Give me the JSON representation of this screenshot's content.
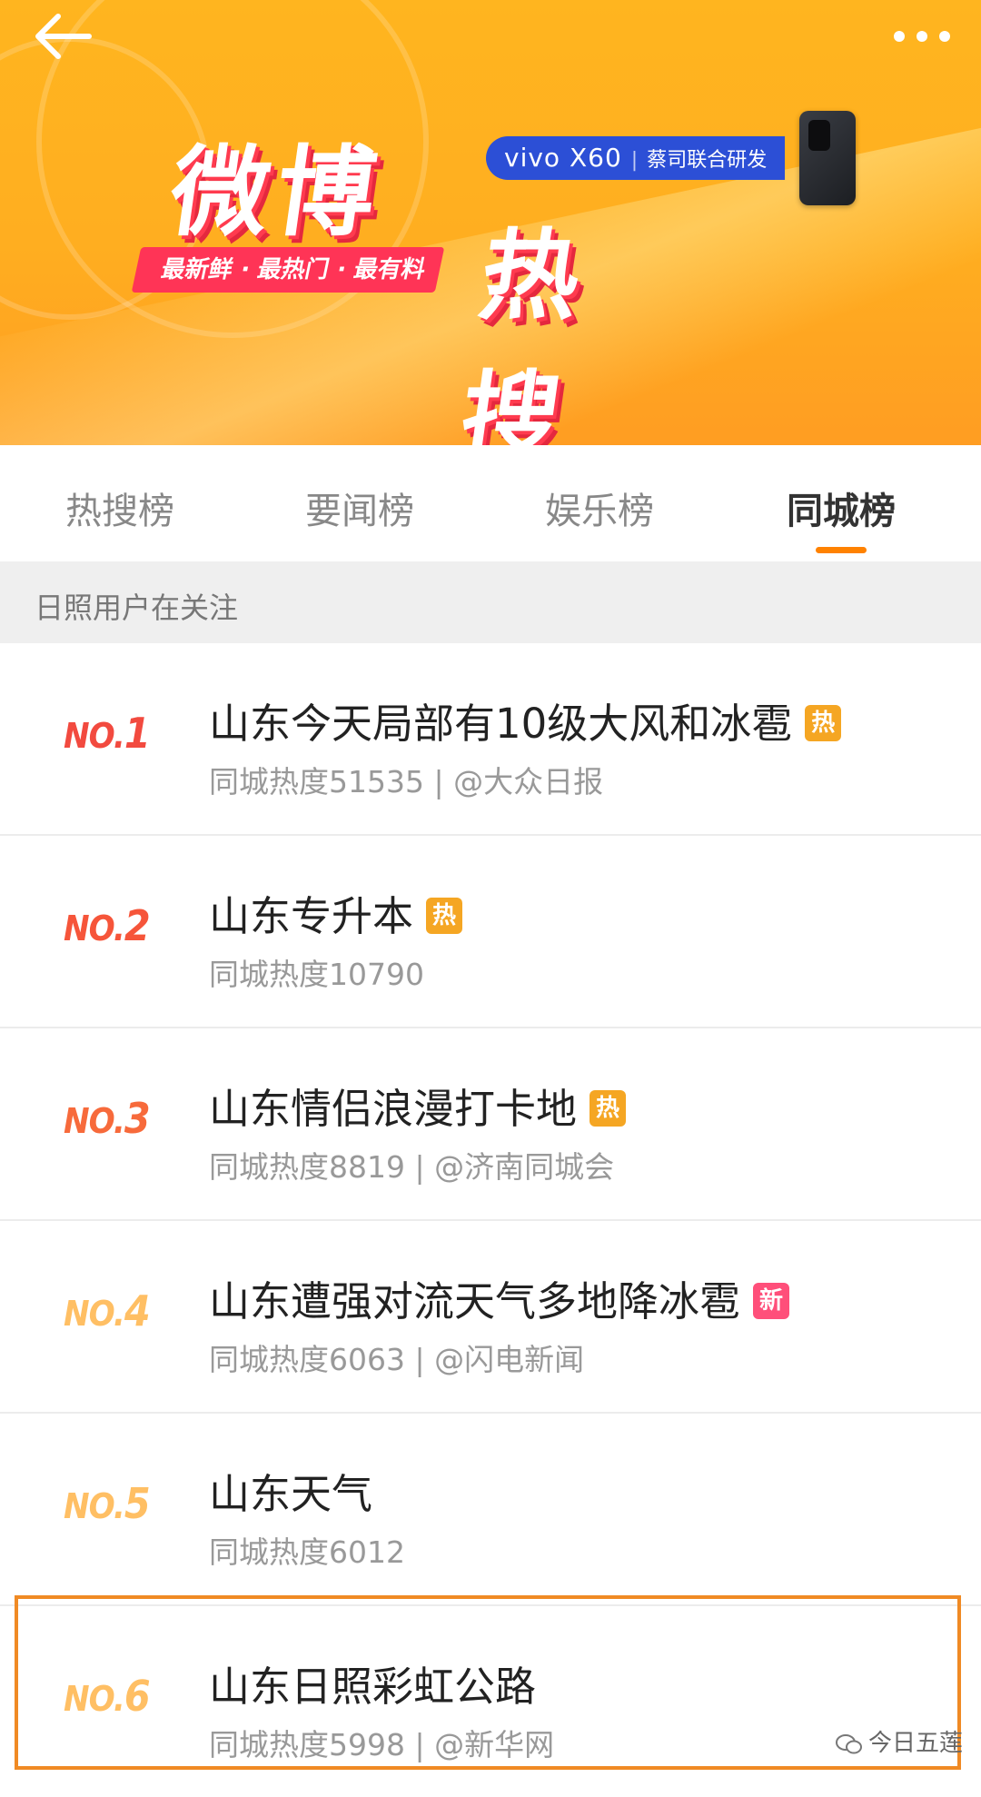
{
  "banner": {
    "title_top": "微博",
    "title_bottom": "热搜",
    "slogan": "最新鲜 · 最热门 · 最有料",
    "sponsor_brand": "vivo X60",
    "sponsor_text": "蔡司联合研发",
    "icons": {
      "back": "back-arrow-icon",
      "more": "more-dots-icon"
    }
  },
  "tabs": [
    {
      "label": "热搜榜",
      "active": false
    },
    {
      "label": "要闻榜",
      "active": false
    },
    {
      "label": "娱乐榜",
      "active": false
    },
    {
      "label": "同城榜",
      "active": true
    }
  ],
  "section_header": "日照用户在关注",
  "items": [
    {
      "rank_prefix": "NO.",
      "rank": "1",
      "title": "山东今天局部有10级大风和冰雹",
      "badge": "热",
      "badge_type": "hot",
      "meta": "同城热度51535 | @大众日报"
    },
    {
      "rank_prefix": "NO.",
      "rank": "2",
      "title": "山东专升本",
      "badge": "热",
      "badge_type": "hot",
      "meta": "同城热度10790"
    },
    {
      "rank_prefix": "NO.",
      "rank": "3",
      "title": "山东情侣浪漫打卡地",
      "badge": "热",
      "badge_type": "hot",
      "meta": "同城热度8819 | @济南同城会"
    },
    {
      "rank_prefix": "NO.",
      "rank": "4",
      "title": "山东遭强对流天气多地降冰雹",
      "badge": "新",
      "badge_type": "new",
      "meta": "同城热度6063 | @闪电新闻"
    },
    {
      "rank_prefix": "NO.",
      "rank": "5",
      "title": "山东天气",
      "badge": "",
      "badge_type": "",
      "meta": "同城热度6012"
    },
    {
      "rank_prefix": "NO.",
      "rank": "6",
      "title": "山东日照彩虹公路",
      "badge": "",
      "badge_type": "",
      "meta": "同城热度5998 | @新华网"
    }
  ],
  "watermark": "今日五莲",
  "colors": {
    "accent": "#ff8200",
    "hot_badge": "#f5a623",
    "new_badge": "#ff4f7a",
    "highlight_border": "#f08a24"
  }
}
